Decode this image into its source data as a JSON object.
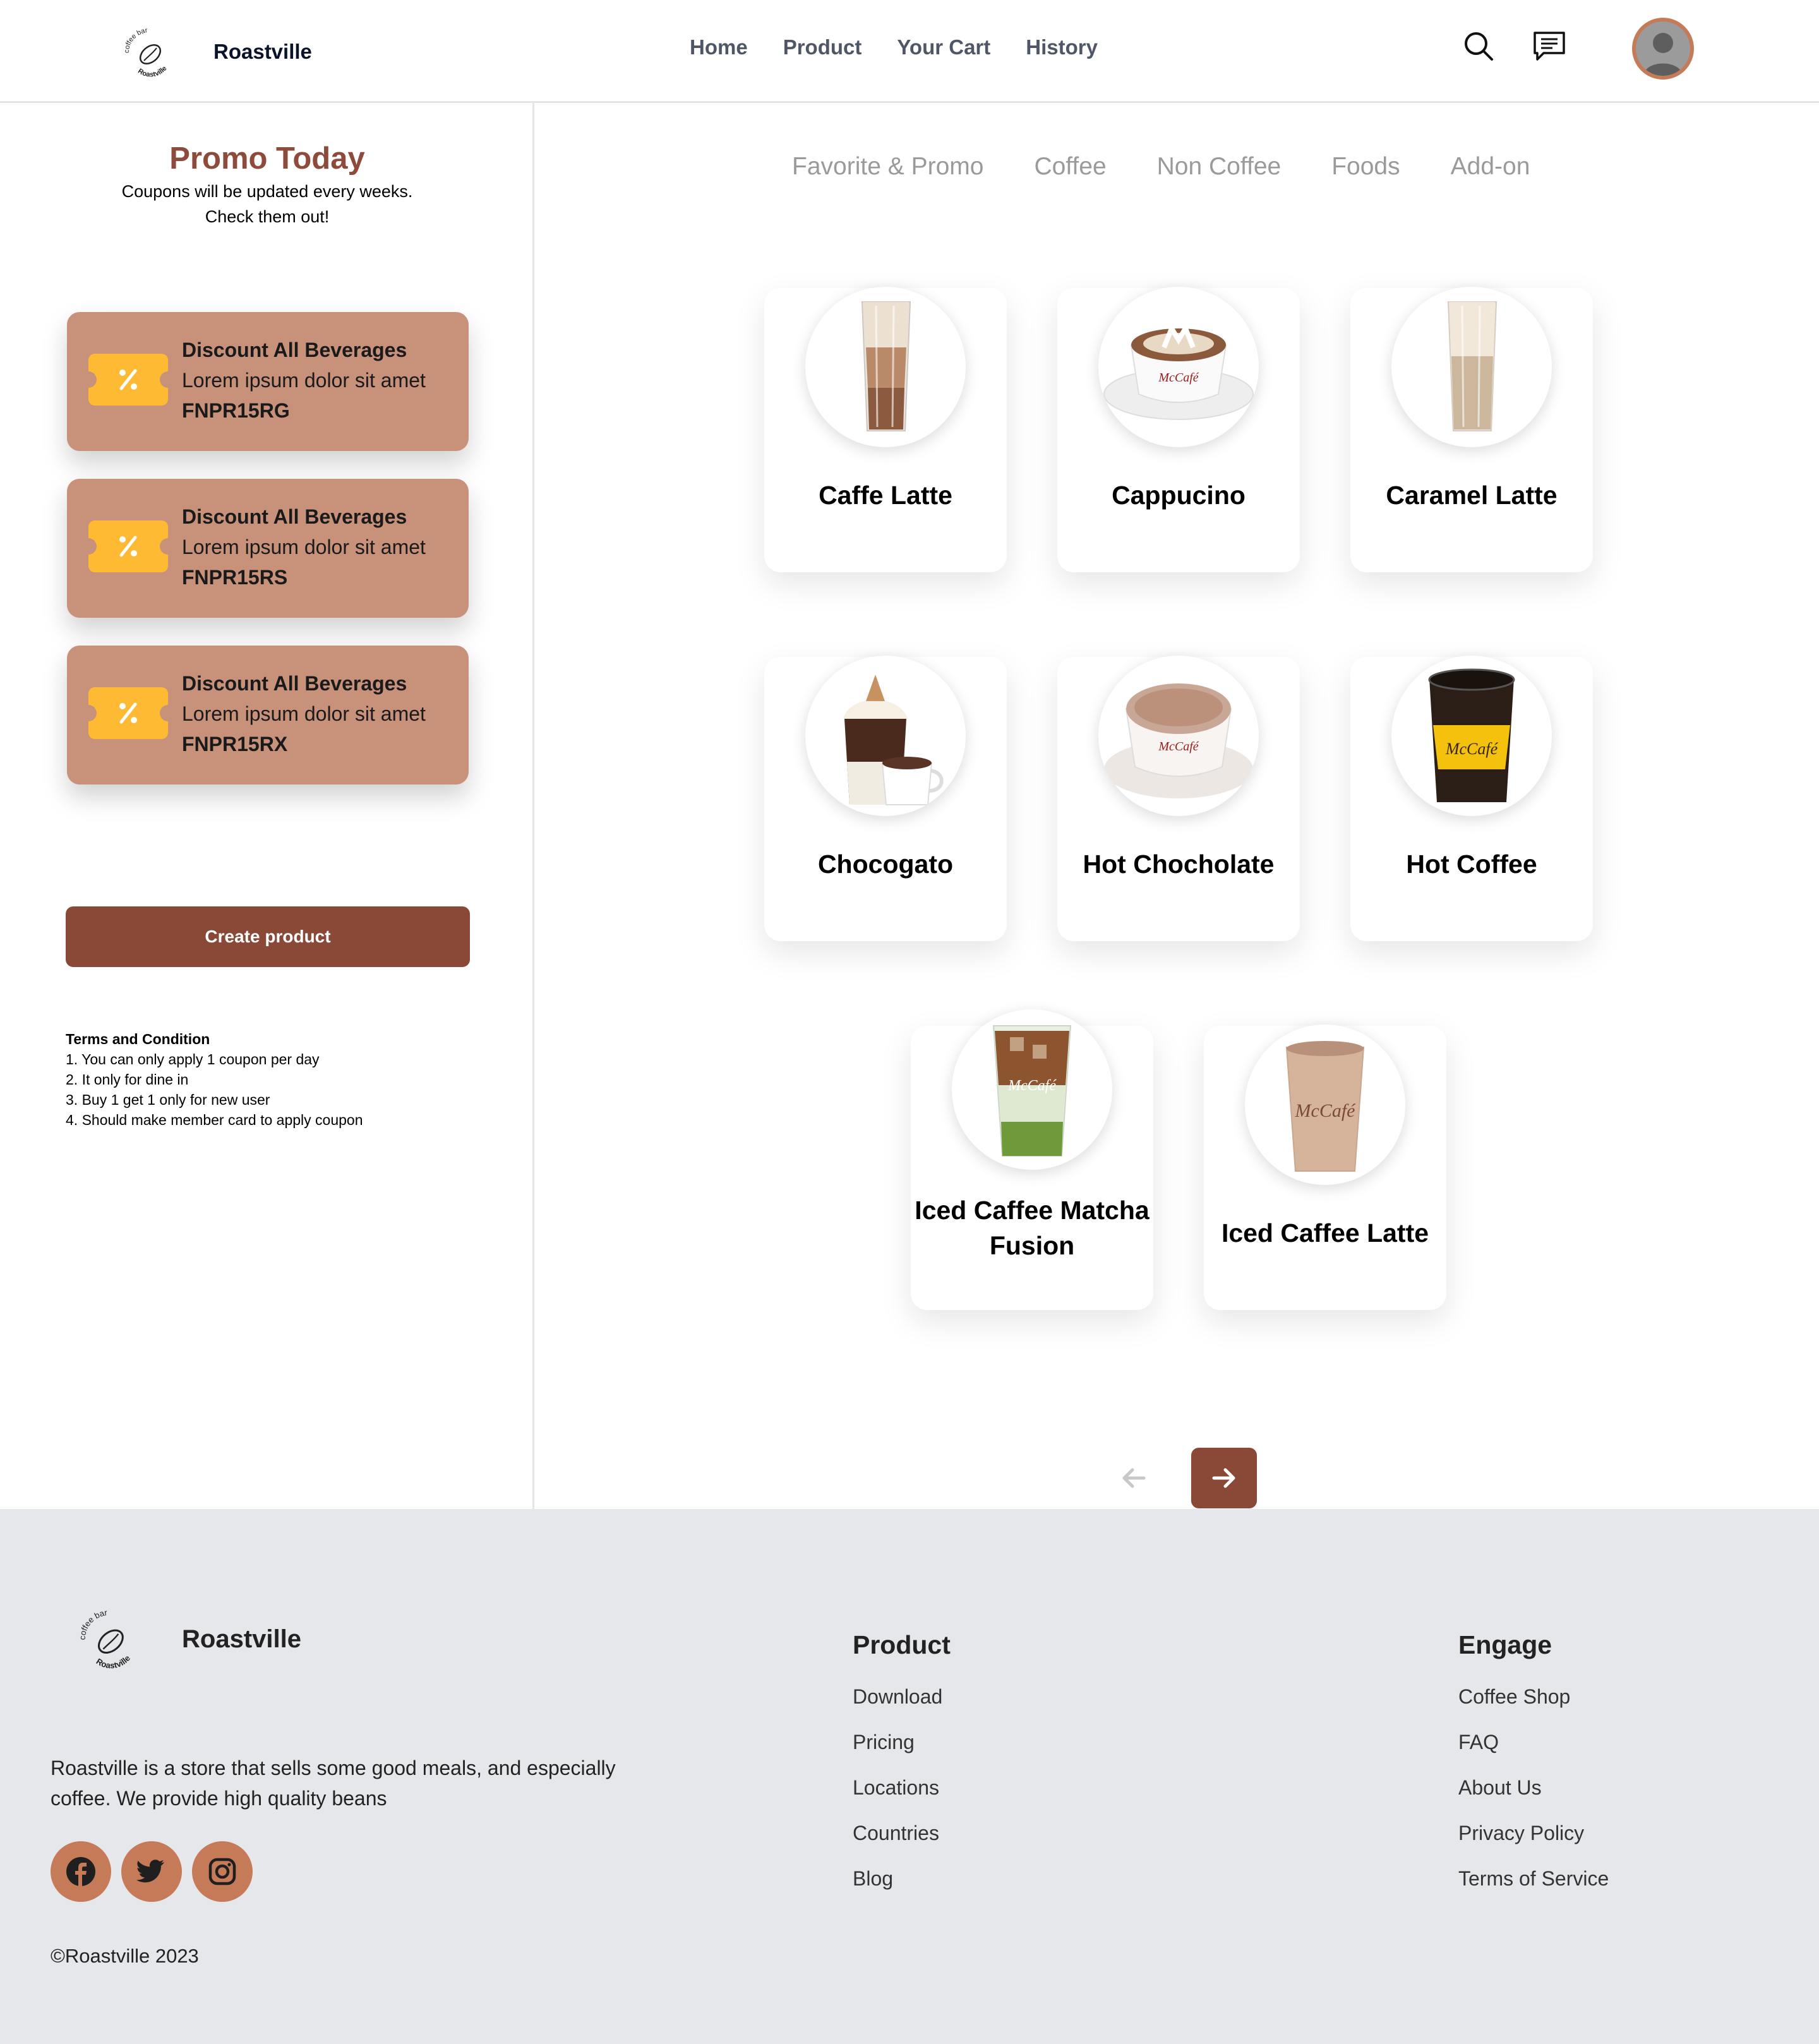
{
  "header": {
    "brand": "Roastville",
    "logo_text": "coffee bar Roastville",
    "nav": [
      "Home",
      "Product",
      "Your Cart",
      "History"
    ]
  },
  "promo": {
    "title": "Promo Today",
    "subtitle": "Coupons will be updated every weeks. Check them out!",
    "coupons": [
      {
        "title": "Discount All Beverages",
        "desc": "Lorem ipsum dolor sit amet",
        "code": "FNPR15RG"
      },
      {
        "title": "Discount All Beverages",
        "desc": "Lorem ipsum dolor sit amet",
        "code": "FNPR15RS"
      },
      {
        "title": "Discount All Beverages",
        "desc": "Lorem ipsum dolor sit amet",
        "code": "FNPR15RX"
      }
    ],
    "create_button": "Create product",
    "terms_title": "Terms and Condition",
    "terms": [
      "1. You can only apply 1 coupon per day",
      "2. It only for dine in",
      "3. Buy 1 get 1 only for new user",
      "4. Should make member card to apply coupon"
    ]
  },
  "tabs": [
    "Favorite & Promo",
    "Coffee",
    "Non Coffee",
    "Foods",
    "Add-on"
  ],
  "products": [
    {
      "name": "Caffe Latte"
    },
    {
      "name": "Cappucino"
    },
    {
      "name": "Caramel Latte"
    },
    {
      "name": "Chocogato"
    },
    {
      "name": "Hot Chocholate"
    },
    {
      "name": "Hot Coffee"
    },
    {
      "name": "Iced Caffee Matcha Fusion"
    },
    {
      "name": "Iced Caffee Latte"
    }
  ],
  "product_image_text": "McCafé",
  "footer": {
    "brand": "Roastville",
    "description": "Roastville is a store that sells some good meals, and especially coffee. We provide high quality beans",
    "copyright": "©Roastville 2023",
    "product_title": "Product",
    "product_links": [
      "Download",
      "Pricing",
      "Locations",
      "Countries",
      "Blog"
    ],
    "engage_title": "Engage",
    "engage_links": [
      "Coffee Shop",
      "FAQ",
      "About Us",
      "Privacy Policy",
      "Terms of Service"
    ]
  },
  "colors": {
    "brand_brown": "#8a4937",
    "coupon_bg": "#c8917a",
    "accent_orange": "#c57b57",
    "coupon_icon": "#ffba33",
    "footer_bg": "#e6e7eb"
  },
  "icons": {
    "search": "search-icon",
    "chat": "chat-icon",
    "avatar": "avatar",
    "coupon": "discount-ticket-icon",
    "prev": "arrow-left-icon",
    "next": "arrow-right-icon",
    "facebook": "facebook-icon",
    "twitter": "twitter-icon",
    "instagram": "instagram-icon"
  }
}
